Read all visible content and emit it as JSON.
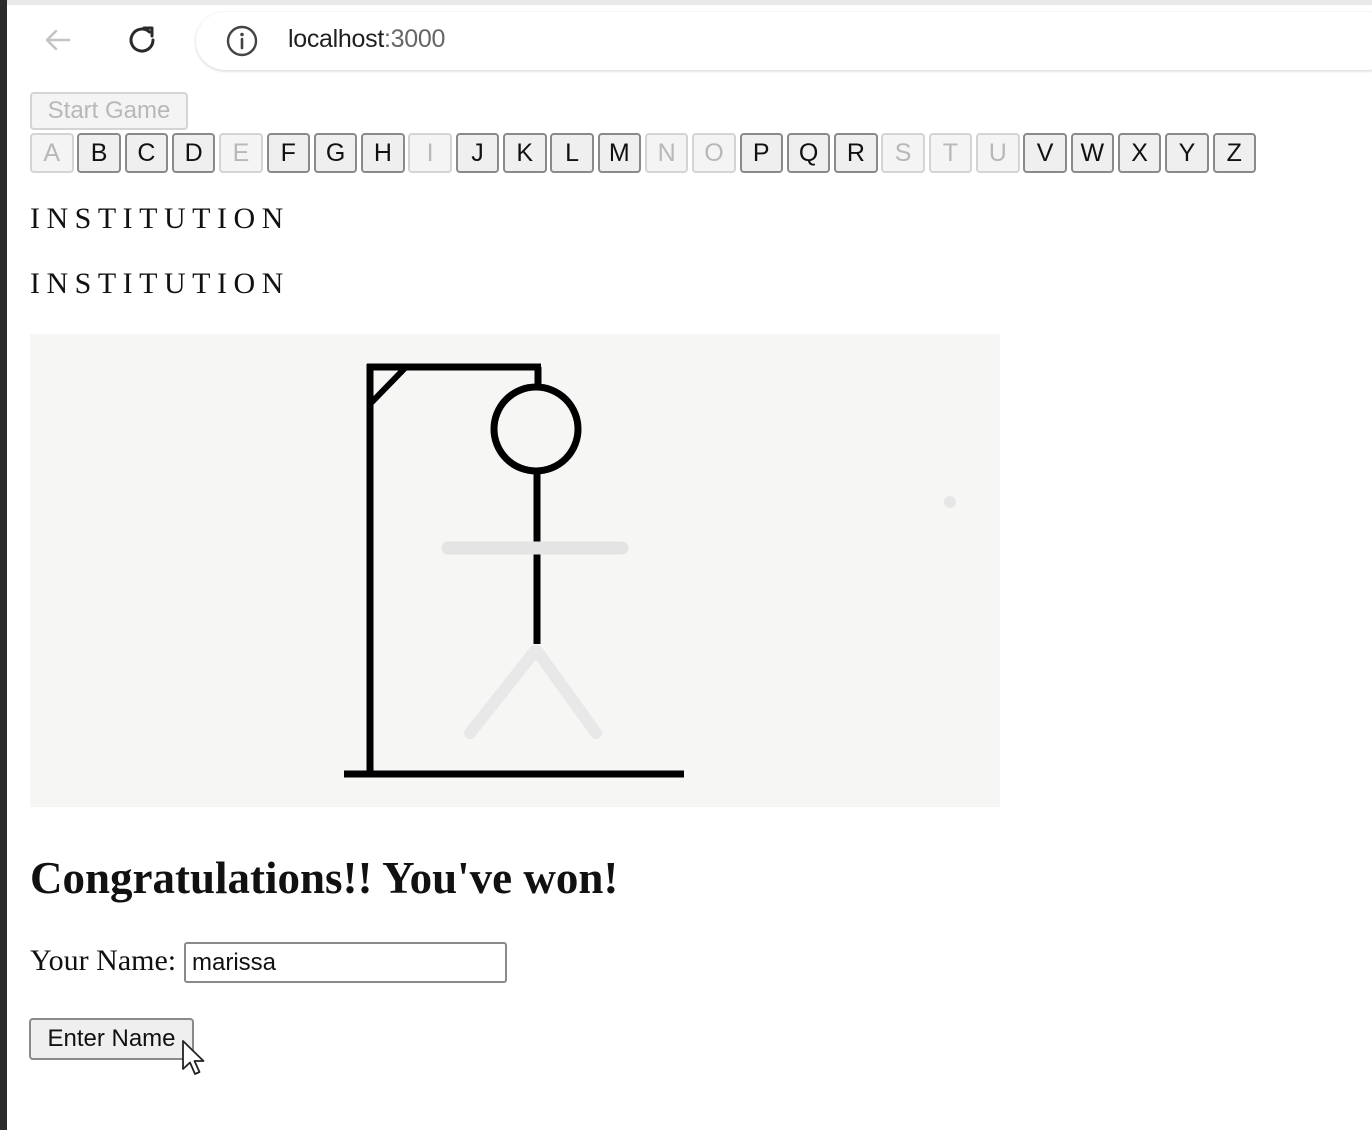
{
  "browser": {
    "url_host": "localhost",
    "url_port": ":3000"
  },
  "game": {
    "start_label": "Start Game",
    "letters": [
      {
        "label": "A",
        "disabled": true
      },
      {
        "label": "B",
        "disabled": false
      },
      {
        "label": "C",
        "disabled": false
      },
      {
        "label": "D",
        "disabled": false
      },
      {
        "label": "E",
        "disabled": true
      },
      {
        "label": "F",
        "disabled": false
      },
      {
        "label": "G",
        "disabled": false
      },
      {
        "label": "H",
        "disabled": false
      },
      {
        "label": "I",
        "disabled": true
      },
      {
        "label": "J",
        "disabled": false
      },
      {
        "label": "K",
        "disabled": false
      },
      {
        "label": "L",
        "disabled": false
      },
      {
        "label": "M",
        "disabled": false
      },
      {
        "label": "N",
        "disabled": true
      },
      {
        "label": "O",
        "disabled": true
      },
      {
        "label": "P",
        "disabled": false
      },
      {
        "label": "Q",
        "disabled": false
      },
      {
        "label": "R",
        "disabled": false
      },
      {
        "label": "S",
        "disabled": true
      },
      {
        "label": "T",
        "disabled": true
      },
      {
        "label": "U",
        "disabled": true
      },
      {
        "label": "V",
        "disabled": false
      },
      {
        "label": "W",
        "disabled": false
      },
      {
        "label": "X",
        "disabled": false
      },
      {
        "label": "Y",
        "disabled": false
      },
      {
        "label": "Z",
        "disabled": false
      }
    ],
    "word_line_1": "INSTITUTION",
    "word_line_2": "INSTITUTION",
    "result_message": "Congratulations!! You've won!",
    "name_label": "Your Name:",
    "name_value": "marissa",
    "enter_label": "Enter Name"
  }
}
